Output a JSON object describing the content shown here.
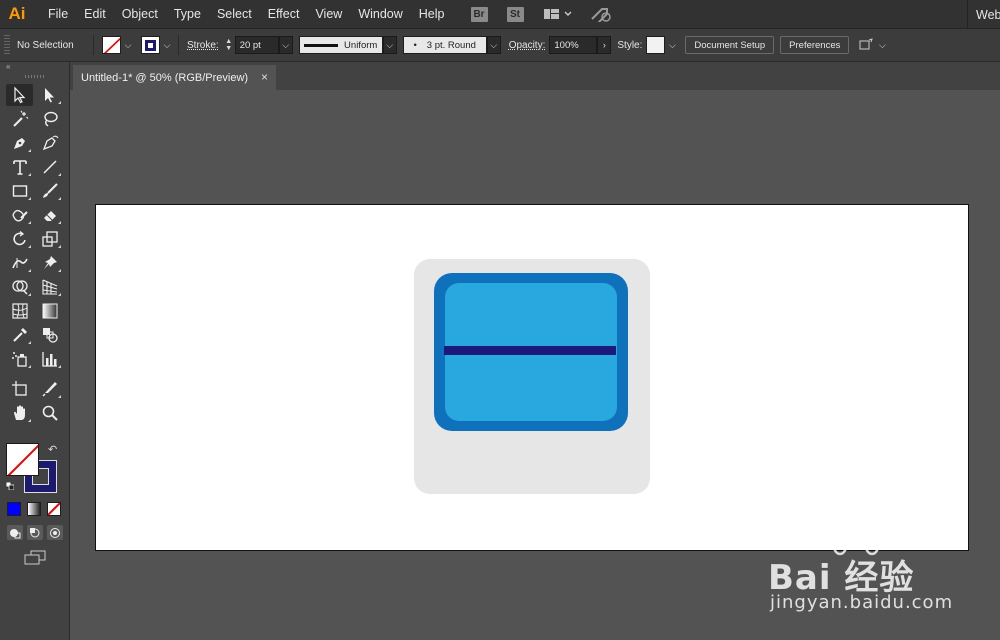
{
  "app": {
    "logo": "Ai"
  },
  "menu": [
    "File",
    "Edit",
    "Object",
    "Type",
    "Select",
    "Effect",
    "View",
    "Window",
    "Help"
  ],
  "menubar_icons": {
    "bridge": "Br",
    "stock": "St",
    "workspace_overflow": "Web"
  },
  "control_bar": {
    "selection_label": "No Selection",
    "stroke_label": "Stroke:",
    "stroke_weight": "20 pt",
    "profile": "Uniform",
    "brush": "3 pt. Round",
    "brush_dot": "•",
    "opacity_label": "Opacity:",
    "opacity_value": "100%",
    "style_label": "Style:",
    "doc_setup": "Document Setup",
    "preferences": "Preferences",
    "stroke_color": "#1b1a6e"
  },
  "tabs": [
    {
      "title": "Untitled-1* @ 50% (RGB/Preview)",
      "close": "×"
    }
  ],
  "toolpanel": {
    "collapse": "«"
  },
  "colors": {
    "fill": "none",
    "stroke": "#1b1a6e",
    "accent": "#ff9a00",
    "art_background": "#e6e6e6",
    "art_frame": "#0f71bc",
    "art_screen": "#29a8e0",
    "art_bar": "#1b1a7a"
  },
  "watermark": {
    "main": "Bai 经验",
    "sub": "jingyan.baidu.com"
  }
}
